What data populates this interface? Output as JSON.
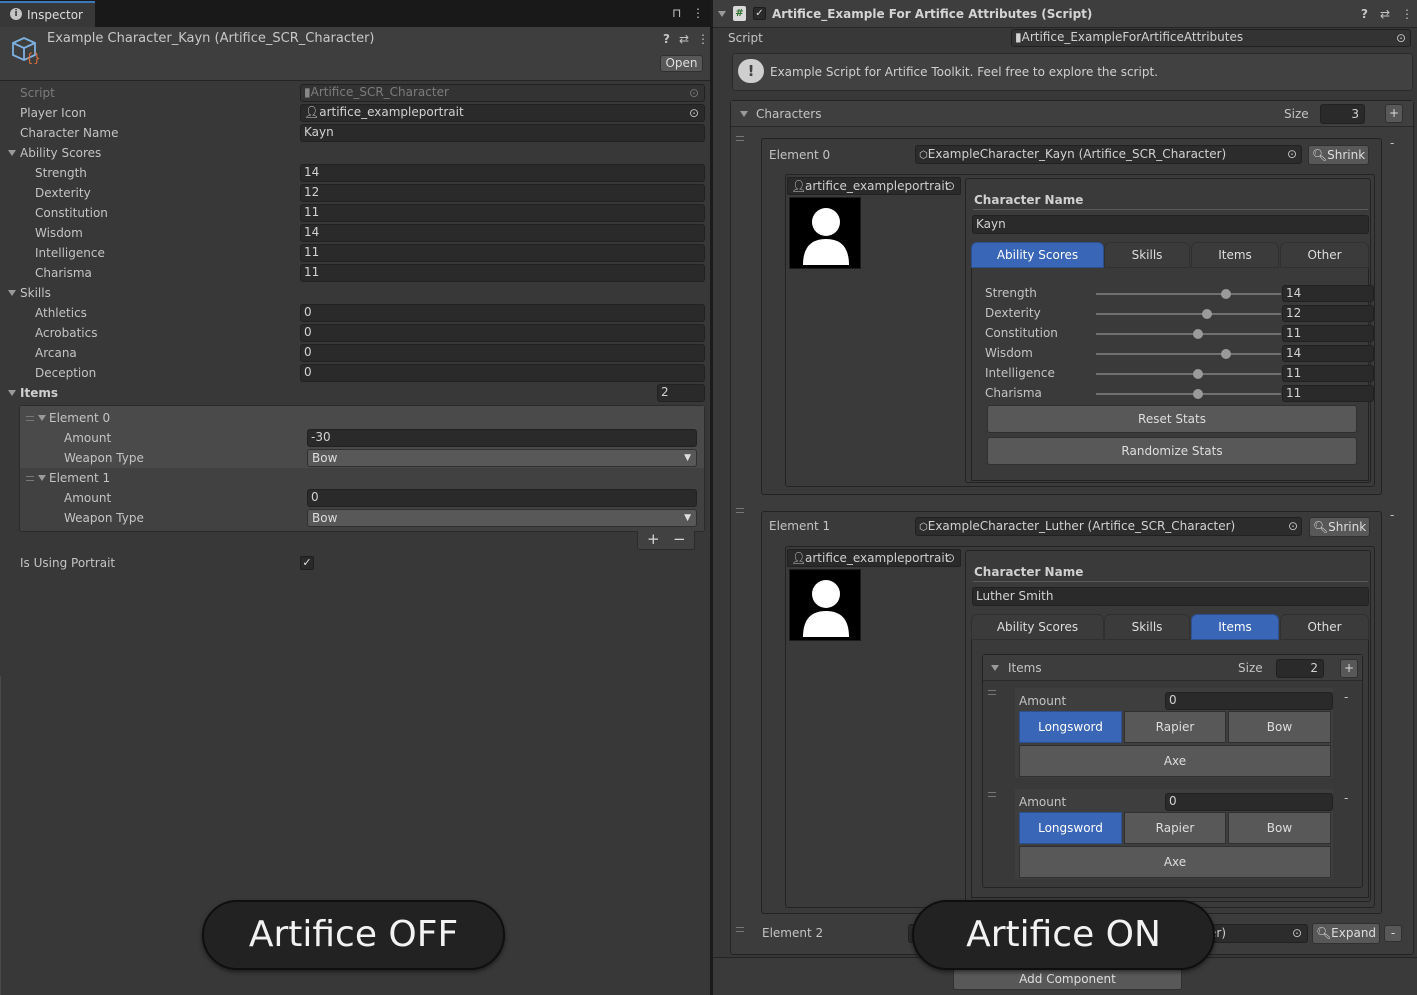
{
  "left": {
    "tab_label": "Inspector",
    "title": "Example Character_Kayn (Artifice_SCR_Character)",
    "open_label": "Open",
    "rows": {
      "script": {
        "label": "Script",
        "value": "Artifice_SCR_Character"
      },
      "player_icon": {
        "label": "Player Icon",
        "value": "artifice_exampleportrait"
      },
      "character_name": {
        "label": "Character Name",
        "value": "Kayn"
      }
    },
    "ability_scores": {
      "label": "Ability Scores",
      "items": [
        {
          "label": "Strength",
          "value": "14"
        },
        {
          "label": "Dexterity",
          "value": "12"
        },
        {
          "label": "Constitution",
          "value": "11"
        },
        {
          "label": "Wisdom",
          "value": "14"
        },
        {
          "label": "Intelligence",
          "value": "11"
        },
        {
          "label": "Charisma",
          "value": "11"
        }
      ]
    },
    "skills": {
      "label": "Skills",
      "items": [
        {
          "label": "Athletics",
          "value": "0"
        },
        {
          "label": "Acrobatics",
          "value": "0"
        },
        {
          "label": "Arcana",
          "value": "0"
        },
        {
          "label": "Deception",
          "value": "0"
        }
      ]
    },
    "items": {
      "label": "Items",
      "size": "2",
      "elements": [
        {
          "label": "Element 0",
          "amount_label": "Amount",
          "amount": "-30",
          "weapon_label": "Weapon Type",
          "weapon": "Bow"
        },
        {
          "label": "Element 1",
          "amount_label": "Amount",
          "amount": "0",
          "weapon_label": "Weapon Type",
          "weapon": "Bow"
        }
      ],
      "add": "+",
      "remove": "−"
    },
    "is_using_portrait": {
      "label": "Is Using Portrait",
      "checked": true
    }
  },
  "right": {
    "title": "Artifice_Example For Artifice Attributes (Script)",
    "script_label": "Script",
    "script_value": "Artifice_ExampleForArtificeAttributes",
    "info": "Example Script for Artifice Toolkit. Feel free to explore the script.",
    "characters": {
      "label": "Characters",
      "size_label": "Size",
      "size": "3",
      "add": "+"
    },
    "tabs": [
      "Ability Scores",
      "Skills",
      "Items",
      "Other"
    ],
    "element0": {
      "label": "Element 0",
      "ref": "ExampleCharacter_Kayn (Artifice_SCR_Character)",
      "shrink": "Shrink",
      "remove": "-",
      "portrait": "artifice_exampleportrait",
      "name_header": "Character Name",
      "name": "Kayn",
      "stats": [
        {
          "label": "Strength",
          "value": "14",
          "frac": 0.7
        },
        {
          "label": "Dexterity",
          "value": "12",
          "frac": 0.6
        },
        {
          "label": "Constitution",
          "value": "11",
          "frac": 0.55
        },
        {
          "label": "Wisdom",
          "value": "14",
          "frac": 0.7
        },
        {
          "label": "Intelligence",
          "value": "11",
          "frac": 0.55
        },
        {
          "label": "Charisma",
          "value": "11",
          "frac": 0.55
        }
      ],
      "reset": "Reset Stats",
      "randomize": "Randomize Stats"
    },
    "element1": {
      "label": "Element 1",
      "ref": "ExampleCharacter_Luther (Artifice_SCR_Character)",
      "shrink": "Shrink",
      "remove": "-",
      "portrait": "artifice_exampleportrait",
      "name_header": "Character Name",
      "name": "Luther Smith",
      "items": {
        "label": "Items",
        "size_label": "Size",
        "size": "2",
        "add": "+",
        "entries": [
          {
            "amount_label": "Amount",
            "amount": "0",
            "remove": "-"
          },
          {
            "amount_label": "Amount",
            "amount": "0",
            "remove": "-"
          }
        ],
        "weapons": [
          "Longsword",
          "Rapier",
          "Bow",
          "Axe"
        ]
      }
    },
    "element2": {
      "label": "Element 2",
      "ref_tail": "er)",
      "expand": "Expand",
      "remove": "-"
    },
    "add_component": "Add Component"
  },
  "overlays": {
    "off": "Artifice OFF",
    "on": "Artifice ON"
  },
  "colors": {
    "accent": "#3a66b7",
    "panel": "#383838",
    "field": "#2a2a2a"
  }
}
